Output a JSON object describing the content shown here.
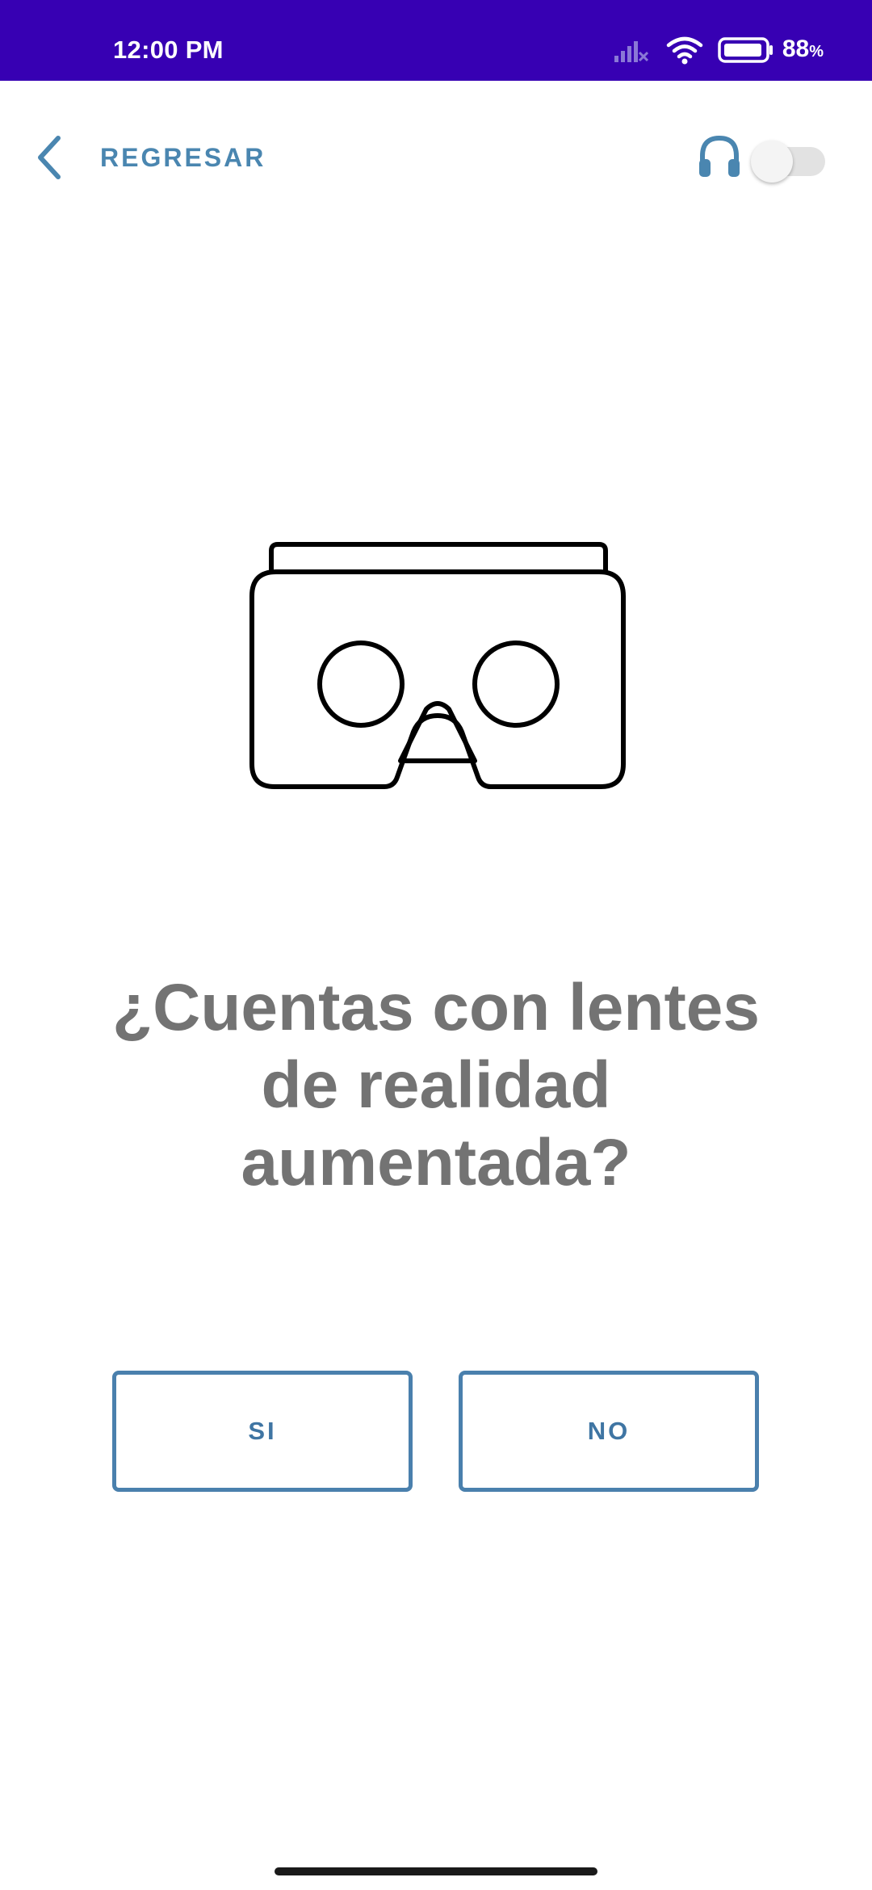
{
  "status_bar": {
    "time": "12:00 PM",
    "battery_percent": "88",
    "battery_unit": "%",
    "battery_level": 0.88,
    "background_color": "#3700b3",
    "icons": [
      "signal-icon",
      "wifi-icon",
      "battery-icon"
    ]
  },
  "header": {
    "back_label": "REGRESAR",
    "back_icon": "chevron-left-icon",
    "audio_icon": "headphones-icon",
    "audio_toggle_on": false,
    "accent_color": "#4a86b0"
  },
  "illustration": {
    "icon": "vr-headset-icon"
  },
  "question": {
    "text": "¿Cuentas con lentes de realidad aumentada?",
    "color": "#737373"
  },
  "answers": {
    "yes_label": "SI",
    "no_label": "NO",
    "border_color": "#4a80ad"
  }
}
